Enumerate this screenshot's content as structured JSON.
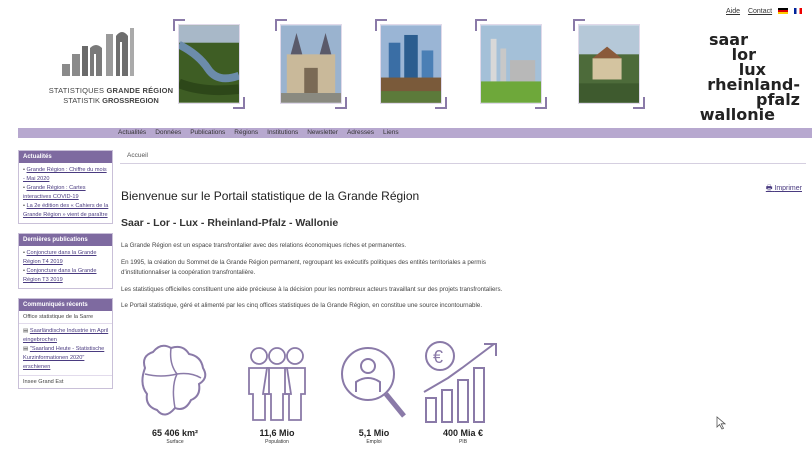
{
  "header": {
    "logo_line1_plain": "STATISTIQUES ",
    "logo_line1_bold": "GRANDE RÉGION",
    "logo_line2_plain": "STATISTIK ",
    "logo_line2_bold": "GROSSREGION",
    "regions": [
      "saar",
      "lor",
      "lux",
      "rheinland-pfalz",
      "wallonie"
    ],
    "links": [
      "Aide",
      "Contact"
    ]
  },
  "nav": [
    "Actualités",
    "Données",
    "Publications",
    "Régions",
    "Institutions",
    "Newsletter",
    "Adresses",
    "Liens"
  ],
  "sidebar": {
    "actualites": {
      "title": "Actualités",
      "items": [
        "Grande Région : Chiffre du mois - Mai 2020",
        "Grande Région : Cartes interactives COVID-19",
        "La 2e édition des « Cahiers de la Grande Région » vient de paraître"
      ]
    },
    "publications": {
      "title": "Dernières publications",
      "items": [
        "Conjoncture dans la Grande Région T4 2019",
        "Conjoncture dans la Grande Région T3 2019"
      ]
    },
    "communiques": {
      "title": "Communiqués récents",
      "office1": "Office statistique de la Sarre",
      "items": [
        "Saarländische Industrie im April eingebrochen",
        "\"Saarland Heute - Statistische Kurzinformationen 2020\" erschienen"
      ],
      "office2": "Insee Grand Est"
    }
  },
  "main": {
    "breadcrumb": "Accueil",
    "print_label": "Imprimer",
    "title": "Bienvenue sur le Portail statistique de la Grande Région",
    "subtitle": "Saar - Lor - Lux - Rheinland-Pfalz - Wallonie",
    "paragraphs": [
      "La Grande Région est un espace transfrontalier avec des relations économiques riches et permanentes.",
      "En 1995, la création du Sommet de la Grande Région permanent, regroupant les exécutifs politiques des entités territoriales a permis d'institutionnaliser la coopération transfrontalière.",
      "Les statistiques officielles constituent une aide précieuse à la décision pour les nombreux acteurs travaillant sur des projets transfrontaliers.",
      "Le Portail statistique, géré et alimenté par les cinq offices statistiques de la Grande Région, en constitue une source incontournable."
    ],
    "stats": [
      {
        "value": "65 406 km²",
        "label": "Surface",
        "icon": "map-icon"
      },
      {
        "value": "11,6 Mio",
        "label": "Population",
        "icon": "people-icon"
      },
      {
        "value": "5,1 Mio",
        "label": "Emploi",
        "icon": "job-search-icon"
      },
      {
        "value": "400 Mia €",
        "label": "PIB",
        "icon": "growth-chart-icon"
      }
    ]
  },
  "colors": {
    "accent": "#7e6aa0",
    "nav_bar": "#b7a8cf",
    "link": "#4a3b80",
    "icon_stroke": "#8a7aa8"
  }
}
